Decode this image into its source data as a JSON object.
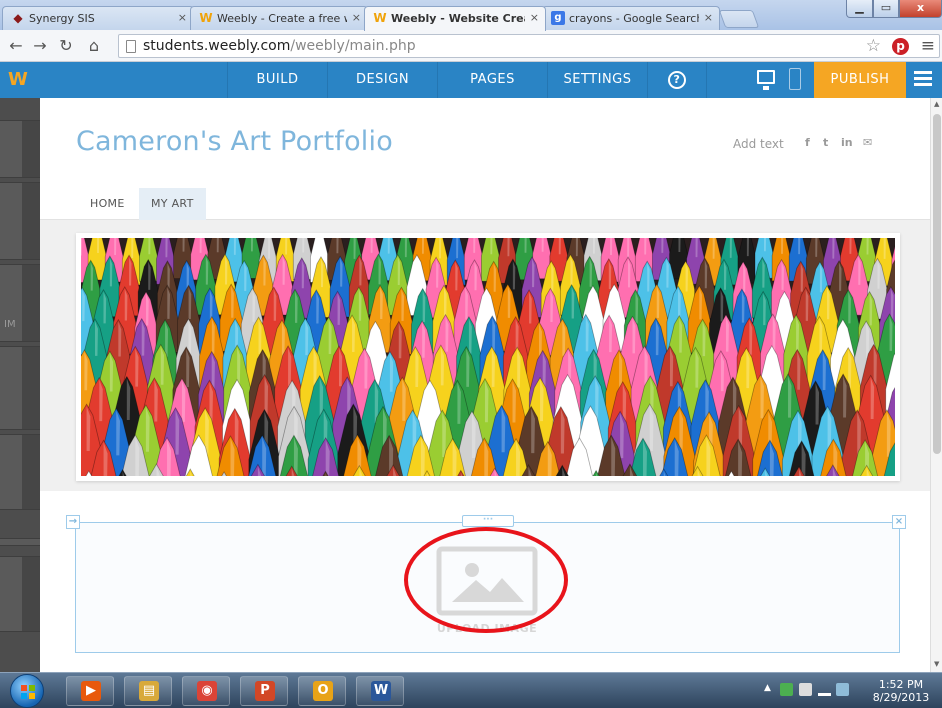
{
  "browser": {
    "tabs": [
      {
        "title": "Synergy SIS",
        "icon": "synergy-icon"
      },
      {
        "title": "Weebly - Create a free wel",
        "icon": "weebly-icon"
      },
      {
        "title": "Weebly - Website Creatior",
        "icon": "weebly-icon"
      },
      {
        "title": "crayons - Google Search",
        "icon": "google-icon"
      }
    ],
    "close_glyph": "×",
    "url_host": "students.weebly.com",
    "url_path": "/weebly/main.php",
    "window_buttons": {
      "minimize": "▁",
      "maximize": "▭",
      "close": "x"
    }
  },
  "weebly_bar": {
    "logo": "W",
    "tabs": {
      "build": "BUILD",
      "design": "DESIGN",
      "pages": "PAGES",
      "settings": "SETTINGS"
    },
    "help": "?",
    "publish": "PUBLISH",
    "colors": {
      "bar": "#2a84c5",
      "publish": "#f5a623"
    }
  },
  "left_panel": {
    "partial_label": "IM"
  },
  "site": {
    "title": "Cameron's Art Portfolio",
    "add_text": "Add text",
    "social": {
      "facebook": "f",
      "twitter": "t",
      "linkedin": "in",
      "email": "✉"
    },
    "nav": {
      "home": "HOME",
      "my_art": "MY ART"
    },
    "banner_subject": "crayons",
    "image_block": {
      "upload_label": "UPLOAD IMAGE",
      "move": "→",
      "delete": "×",
      "handle": "···"
    },
    "title_color": "#7fb6dc"
  },
  "taskbar": {
    "apps": [
      {
        "name": "media-player",
        "glyph": "▶",
        "color": "#e8590c"
      },
      {
        "name": "file-explorer",
        "glyph": "▤",
        "color": "#d8a93a"
      },
      {
        "name": "chrome",
        "glyph": "◉",
        "color": "#db4437"
      },
      {
        "name": "powerpoint",
        "glyph": "P",
        "color": "#d24726"
      },
      {
        "name": "outlook",
        "glyph": "O",
        "color": "#e8a317"
      },
      {
        "name": "word",
        "glyph": "W",
        "color": "#2b579a"
      }
    ],
    "time": "1:52 PM",
    "date": "8/29/2013"
  }
}
